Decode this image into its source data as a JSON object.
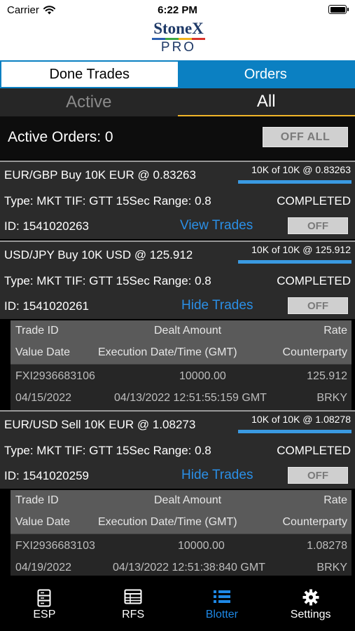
{
  "status_bar": {
    "carrier": "Carrier",
    "time": "6:22 PM"
  },
  "logo": {
    "name": "StoneX",
    "sub": "PRO"
  },
  "top_tabs": [
    {
      "label": "Done Trades",
      "selected": true
    },
    {
      "label": "Orders",
      "selected": false
    }
  ],
  "sub_tabs": [
    {
      "label": "Active",
      "selected": false
    },
    {
      "label": "All",
      "selected": true
    }
  ],
  "active_orders": {
    "label": "Active Orders: 0",
    "off_all_label": "OFF ALL"
  },
  "orders": [
    {
      "title": "EUR/GBP Buy 10K EUR @ 0.83263",
      "fill_text": "10K of 10K @ 0.83263",
      "type_text": "Type: MKT TIF: GTT 15Sec Range: 0.8",
      "status": "COMPLETED",
      "id_text": "ID: 1541020263",
      "link": "View Trades",
      "off_label": "OFF"
    },
    {
      "title": "USD/JPY Buy 10K USD @ 125.912",
      "fill_text": "10K of 10K @ 125.912",
      "type_text": "Type: MKT TIF: GTT 15Sec Range: 0.8",
      "status": "COMPLETED",
      "id_text": "ID: 1541020261",
      "link": "Hide Trades",
      "off_label": "OFF",
      "trade": {
        "headers": [
          "Trade ID",
          "Dealt Amount",
          "Rate",
          "Value Date",
          "Execution Date/Time (GMT)",
          "Counterparty"
        ],
        "trade_id": "FXI2936683106",
        "dealt_amount": "10000.00",
        "rate": "125.912",
        "value_date": "04/15/2022",
        "exec_time": "04/13/2022 12:51:55:159 GMT",
        "counterparty": "BRKY"
      }
    },
    {
      "title": "EUR/USD Sell 10K EUR @ 1.08273",
      "fill_text": "10K of 10K @ 1.08278",
      "type_text": "Type: MKT TIF: GTT 15Sec Range: 0.8",
      "status": "COMPLETED",
      "id_text": "ID: 1541020259",
      "link": "Hide Trades",
      "off_label": "OFF",
      "trade": {
        "headers": [
          "Trade ID",
          "Dealt Amount",
          "Rate",
          "Value Date",
          "Execution Date/Time (GMT)",
          "Counterparty"
        ],
        "trade_id": "FXI2936683103",
        "dealt_amount": "10000.00",
        "rate": "1.08278",
        "value_date": "04/19/2022",
        "exec_time": "04/13/2022 12:51:38:840 GMT",
        "counterparty": "BRKY"
      }
    }
  ],
  "tabbar": [
    {
      "label": "ESP",
      "icon": "server-icon",
      "selected": false
    },
    {
      "label": "RFS",
      "icon": "table-icon",
      "selected": false
    },
    {
      "label": "Blotter",
      "icon": "list-icon",
      "selected": true
    },
    {
      "label": "Settings",
      "icon": "gear-icon",
      "selected": false
    }
  ],
  "colors": {
    "accent": "#0b80c2",
    "link": "#2b8fe6",
    "fill_bar": "#3a9ae2",
    "tab_selected": "#1e88e5",
    "sub_tab_underline": "#f0b429"
  }
}
